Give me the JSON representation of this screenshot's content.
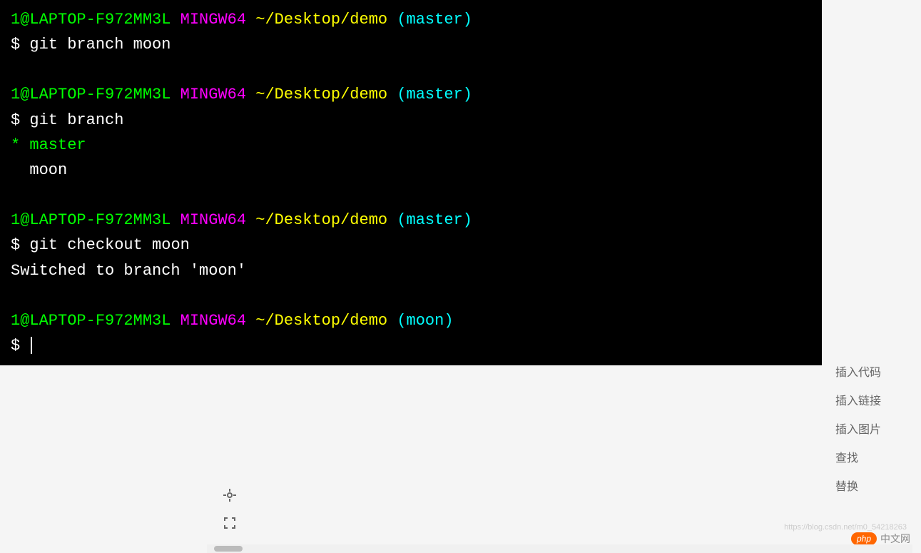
{
  "terminal": {
    "blocks": [
      {
        "prompt": {
          "user_host": "1@LAPTOP-F972MM3L",
          "shell": "MINGW64",
          "path": "~/Desktop/demo",
          "branch": "(master)"
        },
        "command": "git branch moon",
        "output": []
      },
      {
        "prompt": {
          "user_host": "1@LAPTOP-F972MM3L",
          "shell": "MINGW64",
          "path": "~/Desktop/demo",
          "branch": "(master)"
        },
        "command": "git branch",
        "output": [
          {
            "text": "* master",
            "is_current": true
          },
          {
            "text": "  moon",
            "is_current": false
          }
        ]
      },
      {
        "prompt": {
          "user_host": "1@LAPTOP-F972MM3L",
          "shell": "MINGW64",
          "path": "~/Desktop/demo",
          "branch": "(master)"
        },
        "command": "git checkout moon",
        "output": [
          {
            "text": "Switched to branch 'moon'",
            "is_current": false
          }
        ]
      },
      {
        "prompt": {
          "user_host": "1@LAPTOP-F972MM3L",
          "shell": "MINGW64",
          "path": "~/Desktop/demo",
          "branch": "(moon)"
        },
        "command": "",
        "output": [],
        "has_cursor": true
      }
    ]
  },
  "sidebar": {
    "items": [
      {
        "label": "插入代码"
      },
      {
        "label": "插入链接"
      },
      {
        "label": "插入图片"
      },
      {
        "label": "查找"
      },
      {
        "label": "替换"
      }
    ]
  },
  "watermark": {
    "badge": "php",
    "text": "中文网",
    "url": "https://blog.csdn.net/m0_54218263"
  }
}
